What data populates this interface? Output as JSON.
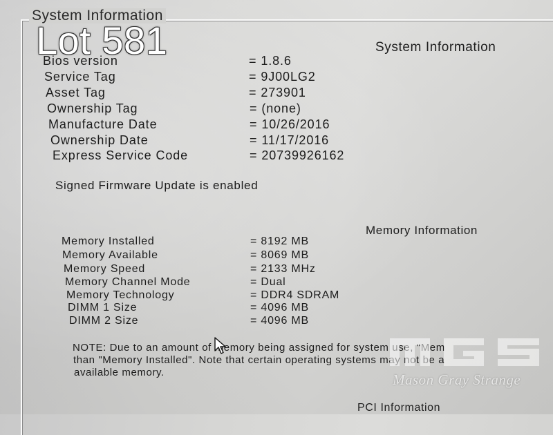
{
  "lot_label": "Lot 581",
  "group_title": "System Information",
  "system_section": {
    "header": "System Information",
    "rows": [
      {
        "label": "Bios version",
        "value": "= 1.8.6"
      },
      {
        "label": "Service Tag",
        "value": "= 9J00LG2"
      },
      {
        "label": "Asset Tag",
        "value": "= 273901"
      },
      {
        "label": "Ownership Tag",
        "value": "= (none)"
      },
      {
        "label": "Manufacture Date",
        "value": "= 10/26/2016"
      },
      {
        "label": "Ownership Date",
        "value": "= 11/17/2016"
      },
      {
        "label": "Express Service Code",
        "value": "= 20739926162"
      }
    ],
    "firmware_status": "Signed Firmware Update is enabled"
  },
  "memory_section": {
    "header": "Memory Information",
    "rows": [
      {
        "label": "Memory Installed",
        "value": "= 8192 MB"
      },
      {
        "label": "Memory Available",
        "value": "= 8069 MB"
      },
      {
        "label": "Memory Speed",
        "value": "= 2133 MHz"
      },
      {
        "label": "Memory Channel Mode",
        "value": "= Dual"
      },
      {
        "label": "Memory Technology",
        "value": "= DDR4 SDRAM"
      },
      {
        "label": "DIMM 1 Size",
        "value": "= 4096 MB"
      },
      {
        "label": "DIMM 2 Size",
        "value": "= 4096 MB"
      }
    ],
    "note_lines": [
      "NOTE: Due to an amount of memory being assigned for system use, \"Mem",
      "than \"Memory Installed\". Note that certain operating systems may not be a",
      "available memory."
    ]
  },
  "pci_section": {
    "header": "PCI Information"
  },
  "watermark": {
    "text": "Mason Gray Strange",
    "logo_letters": "MGS"
  },
  "colors": {
    "screen_bg": "#d4d4d2",
    "text": "#1c1c1c",
    "lot_text": "#ffffff",
    "border_highlight": "#fbfbfb"
  },
  "icons": {
    "cursor": "arrow-pointer-icon"
  }
}
